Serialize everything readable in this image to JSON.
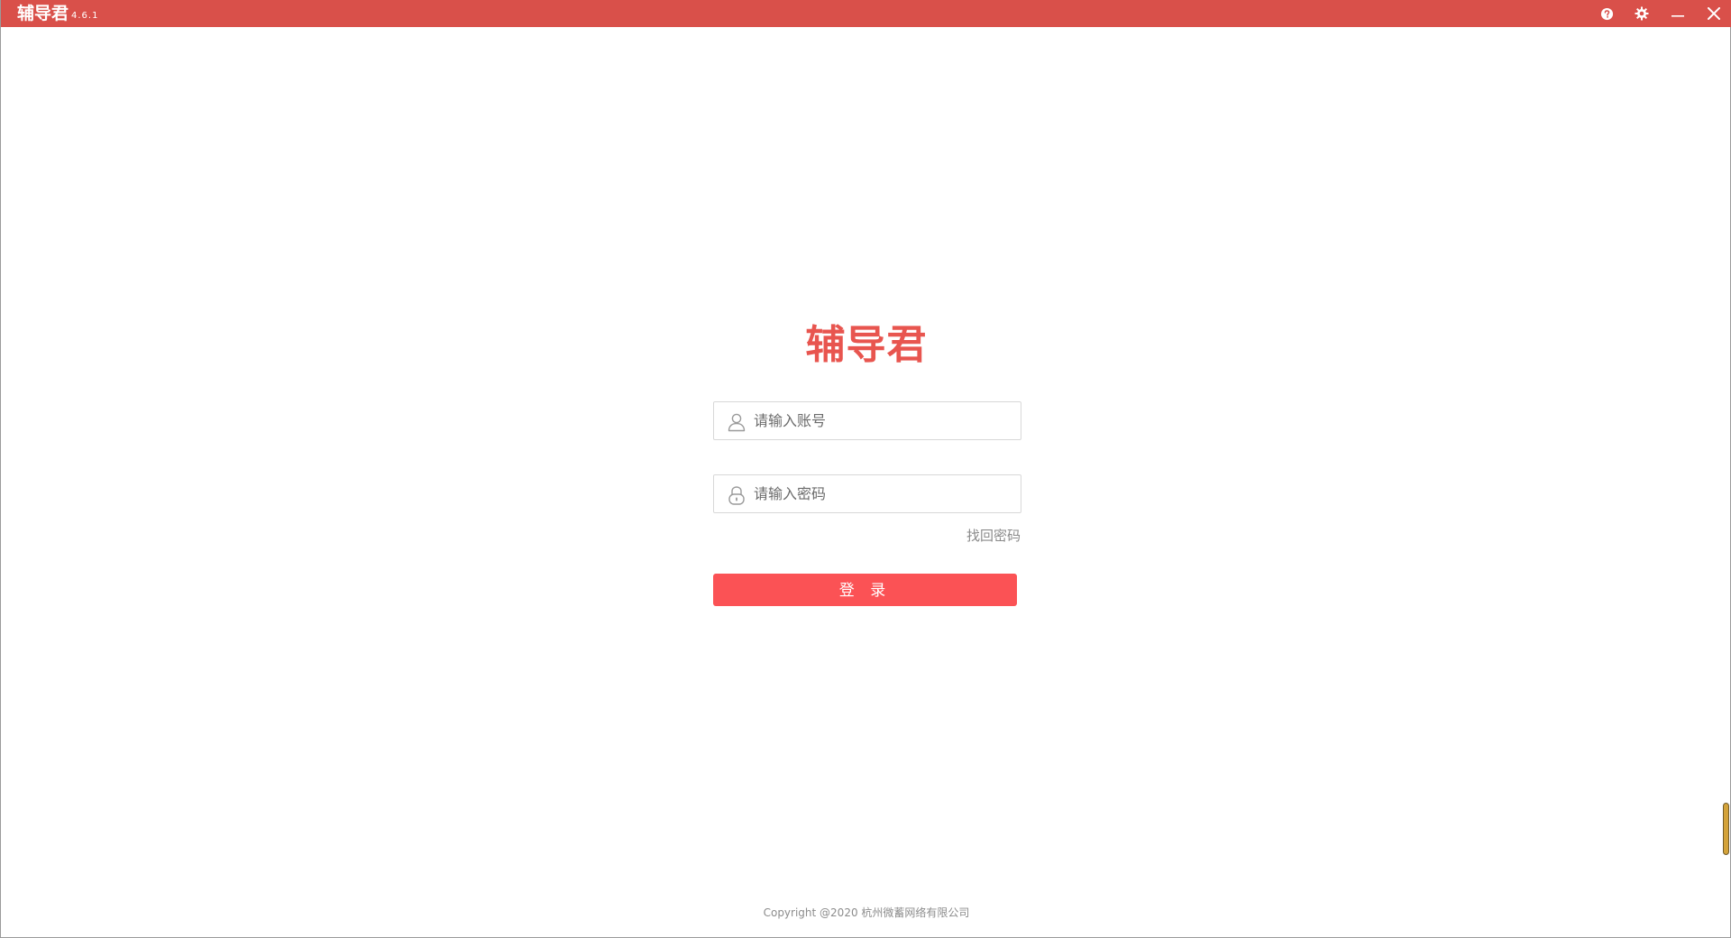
{
  "window": {
    "title": "辅导君",
    "version": "4.6.1",
    "accent_color": "#d9504a",
    "controls": {
      "help_icon": "question-circle-icon",
      "settings_icon": "gear-icon",
      "minimize_icon": "minimize-icon",
      "close_icon": "close-icon"
    }
  },
  "login": {
    "logo_text": "辅导君",
    "logo_color": "#e8554f",
    "account": {
      "placeholder": "请输入账号",
      "value": "",
      "icon": "user-icon"
    },
    "password": {
      "placeholder": "请输入密码",
      "value": "",
      "icon": "lock-icon"
    },
    "forgot_label": "找回密码",
    "submit_label": "登 录",
    "submit_color": "#fb5255"
  },
  "footer": {
    "copyright": "Copyright @2020 杭州微蓄网络有限公司"
  }
}
